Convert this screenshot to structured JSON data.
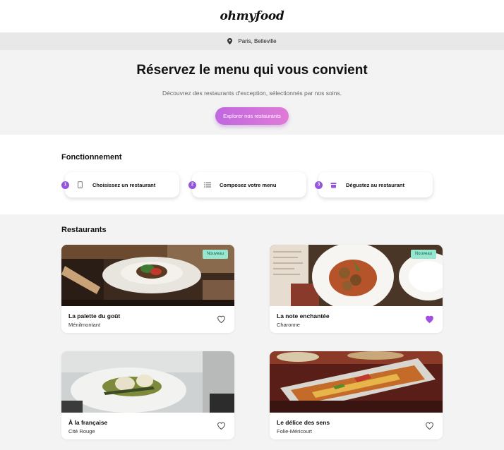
{
  "brand": {
    "logo": "ohmyfood"
  },
  "location": {
    "label": "Paris, Belleville",
    "icon": "location-pin-icon"
  },
  "hero": {
    "title": "Réservez le menu qui vous convient",
    "subtitle": "Découvrez des restaurants d'exception, sélectionnés par nos soins.",
    "cta_label": "Explorer nos restaurants"
  },
  "how_it_works": {
    "title": "Fonctionnement",
    "steps": [
      {
        "number": "1",
        "label": "Choisissez un restaurant",
        "icon": "mobile-phone-icon"
      },
      {
        "number": "2",
        "label": "Composez votre menu",
        "icon": "list-icon"
      },
      {
        "number": "3",
        "label": "Dégustez au restaurant",
        "icon": "food-bowl-icon"
      }
    ]
  },
  "restaurants": {
    "title": "Restaurants",
    "items": [
      {
        "name": "La palette du goût",
        "area": "Ménilmontant",
        "badge": "Nouveau",
        "favorite": false
      },
      {
        "name": "La note enchantée",
        "area": "Charonne",
        "badge": "Nouveau",
        "favorite": true
      },
      {
        "name": "À la française",
        "area": "Cité Rouge",
        "badge": "",
        "favorite": false
      },
      {
        "name": "Le délice des sens",
        "area": "Folie-Méricourt",
        "badge": "",
        "favorite": false
      }
    ]
  },
  "colors": {
    "accent": "#9356dc",
    "cta_gradient_start": "#c067e0",
    "cta_gradient_end": "#e07ad6",
    "badge_bg": "#99e6d0",
    "section_bg": "#f3f3f3"
  }
}
